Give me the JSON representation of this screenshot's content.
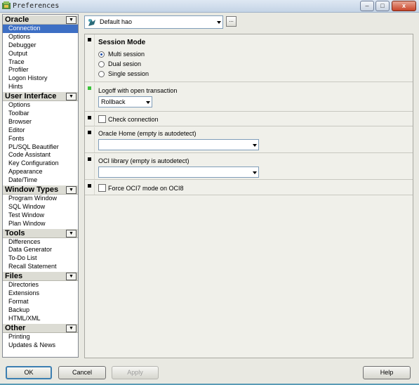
{
  "window": {
    "title": "Preferences"
  },
  "sidebar": {
    "categories": [
      {
        "label": "Oracle",
        "items": [
          "Connection",
          "Options",
          "Debugger",
          "Output",
          "Trace",
          "Profiler",
          "Logon History",
          "Hints"
        ]
      },
      {
        "label": "User Interface",
        "items": [
          "Options",
          "Toolbar",
          "Browser",
          "Editor",
          "Fonts",
          "PL/SQL Beautifier",
          "Code Assistant",
          "Key Configuration",
          "Appearance",
          "Date/Time"
        ]
      },
      {
        "label": "Window Types",
        "items": [
          "Program Window",
          "SQL Window",
          "Test Window",
          "Plan Window"
        ]
      },
      {
        "label": "Tools",
        "items": [
          "Differences",
          "Data Generator",
          "To-Do List",
          "Recall Statement"
        ]
      },
      {
        "label": "Files",
        "items": [
          "Directories",
          "Extensions",
          "Format",
          "Backup",
          "HTML/XML"
        ]
      },
      {
        "label": "Other",
        "items": [
          "Printing",
          "Updates & News"
        ]
      }
    ],
    "selected": "Connection"
  },
  "profile": {
    "value": "Default hao",
    "ellipsis": "..."
  },
  "session_mode": {
    "title": "Session Mode",
    "options": [
      "Multi session",
      "Dual sesion",
      "Single session"
    ],
    "selected_index": 0
  },
  "logoff": {
    "label": "Logoff with open transaction",
    "value": "Rollback"
  },
  "check_connection": {
    "label": "Check connection",
    "checked": false
  },
  "oracle_home": {
    "label": "Oracle Home (empty is autodetect)",
    "value": ""
  },
  "oci_library": {
    "label": "OCI library (empty is autodetect)",
    "value": ""
  },
  "force_oci7": {
    "label": "Force OCI7 mode on OCI8",
    "checked": false
  },
  "buttons": {
    "ok": "OK",
    "cancel": "Cancel",
    "apply": "Apply",
    "help": "Help"
  },
  "colors": {
    "selection": "#3d6fc4",
    "accent": "#3c7fb1",
    "changed_marker": "#3ac23a"
  }
}
